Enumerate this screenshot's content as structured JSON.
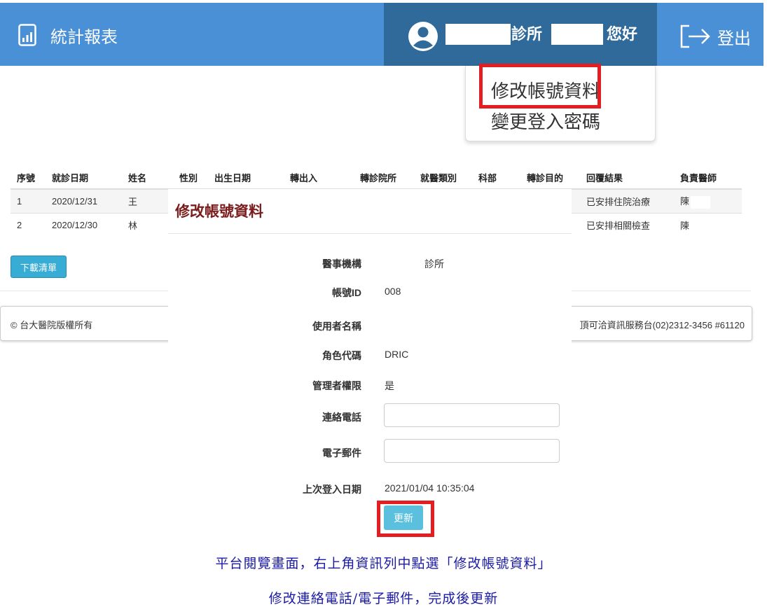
{
  "navbar": {
    "brand": "統計報表",
    "user_clinic_suffix": "診所",
    "user_greeting": "您好",
    "logout": "登出"
  },
  "dropdown": {
    "items": [
      "修改帳號資料",
      "變更登入密碼"
    ]
  },
  "table": {
    "headers": [
      "序號",
      "就診日期",
      "姓名",
      "性別",
      "出生日期",
      "轉出入",
      "轉診院所",
      "就醫類別",
      "科部",
      "轉診目的",
      "回覆結果",
      "負責醫師"
    ],
    "rows": [
      {
        "no": "1",
        "date": "2020/12/31",
        "name": "王",
        "result": "已安排住院治療",
        "doctor": "陳"
      },
      {
        "no": "2",
        "date": "2020/12/30",
        "name": "林",
        "result": "已安排相關檢查",
        "doctor": "陳"
      }
    ]
  },
  "download_button": "下載清單",
  "footer": {
    "left": "© 台大醫院版權所有",
    "right": "頂可洽資訊服務台(02)2312-3456 #61120"
  },
  "modal": {
    "title": "修改帳號資料",
    "fields": [
      {
        "label": "醫事機構",
        "value": "診所"
      },
      {
        "label": "帳號ID",
        "value": "008"
      },
      {
        "label": "使用者名稱",
        "value": ""
      },
      {
        "label": "角色代碼",
        "value": "DRIC"
      },
      {
        "label": "管理者權限",
        "value": "是"
      },
      {
        "label": "連絡電話",
        "value": ""
      },
      {
        "label": "電子郵件",
        "value": ""
      },
      {
        "label": "上次登入日期",
        "value": "2021/01/04 10:35:04"
      }
    ],
    "update_button": "更新"
  },
  "captions": [
    "平台閱覽畫面，右上角資訊列中點選「修改帳號資料」",
    "修改連絡電話/電子郵件，完成後更新"
  ],
  "colors": {
    "navbar": "#4a90d6",
    "navbar_user": "#2f6a9a",
    "highlight": "#e41e20",
    "modal_title": "#7a1c1c",
    "caption": "#1a1aa6",
    "button": "#5bc0de"
  }
}
